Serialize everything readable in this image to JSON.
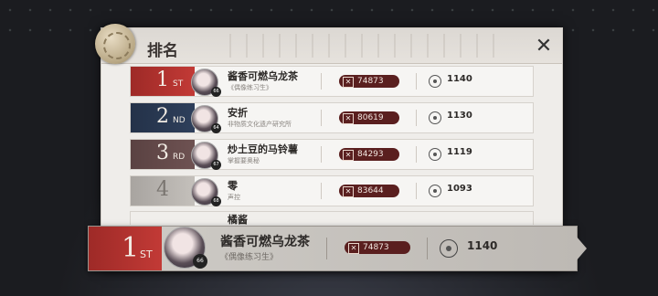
{
  "header": {
    "title": "排名",
    "close_label": "✕"
  },
  "colors": {
    "gold": "#c23a36",
    "silver": "#2e3f5b",
    "bronze": "#6e5252",
    "plain": "#8e8a86"
  },
  "rows": [
    {
      "rank": "1",
      "suffix": "ST",
      "name": "酱香可燃乌龙茶",
      "subtitle": "《偶像练习生》",
      "level": "66",
      "score": "74873",
      "points": "1140",
      "tier": "gold"
    },
    {
      "rank": "2",
      "suffix": "ND",
      "name": "安折",
      "subtitle": "非物质文化遗产研究所",
      "level": "64",
      "score": "80619",
      "points": "1130",
      "tier": "silver"
    },
    {
      "rank": "3",
      "suffix": "RD",
      "name": "炒土豆的马铃薯",
      "subtitle": "掌握要奥秘",
      "level": "67",
      "score": "84293",
      "points": "1119",
      "tier": "bronze"
    },
    {
      "rank": "4",
      "suffix": "",
      "name": "零",
      "subtitle": "声控",
      "level": "68",
      "score": "83644",
      "points": "1093",
      "tier": "plain"
    }
  ],
  "partial_row": {
    "name": "橘酱"
  },
  "my_rank": {
    "rank": "1",
    "suffix": "ST",
    "name": "酱香可燃乌龙茶",
    "subtitle": "《偶像练习生》",
    "level": "66",
    "score": "74873",
    "points": "1140"
  },
  "icons": {
    "score_icon": "crossed-swords-icon",
    "points_icon": "ring-coin-icon"
  }
}
